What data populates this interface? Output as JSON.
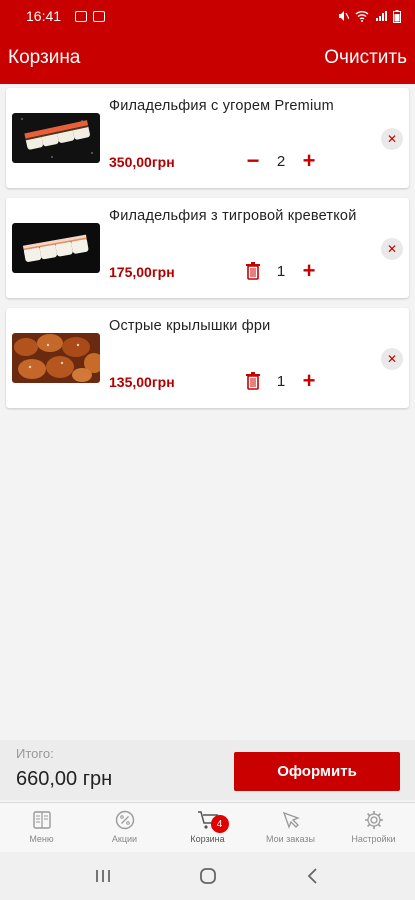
{
  "status_bar": {
    "time": "16:41"
  },
  "app_bar": {
    "title": "Корзина",
    "clear_label": "Очистить"
  },
  "cart_items": [
    {
      "name": "Филадельфия с угорем Premium",
      "price": "350,00грн",
      "quantity": "2",
      "minus_glyph": "−",
      "plus_glyph": "+",
      "remove_glyph": "✕"
    },
    {
      "name": "Филадельфия з тигровой креветкой",
      "price": "175,00грн",
      "quantity": "1",
      "plus_glyph": "+",
      "remove_glyph": "✕"
    },
    {
      "name": "Острые крылышки фри",
      "price": "135,00грн",
      "quantity": "1",
      "plus_glyph": "+",
      "remove_glyph": "✕"
    }
  ],
  "footer": {
    "total_label": "Итого:",
    "total_value": "660,00 грн",
    "checkout_label": "Оформить"
  },
  "tabs": [
    {
      "label": "Меню",
      "icon": "menu-book-icon"
    },
    {
      "label": "Акции",
      "icon": "discount-icon"
    },
    {
      "label": "Корзина",
      "icon": "cart-icon",
      "badge": "4",
      "active": true
    },
    {
      "label": "Мои заказы",
      "icon": "orders-icon"
    },
    {
      "label": "Настройки",
      "icon": "gear-icon"
    }
  ],
  "colors": {
    "brand": "#c80000",
    "price": "#b00000",
    "badge": "#e00000"
  }
}
